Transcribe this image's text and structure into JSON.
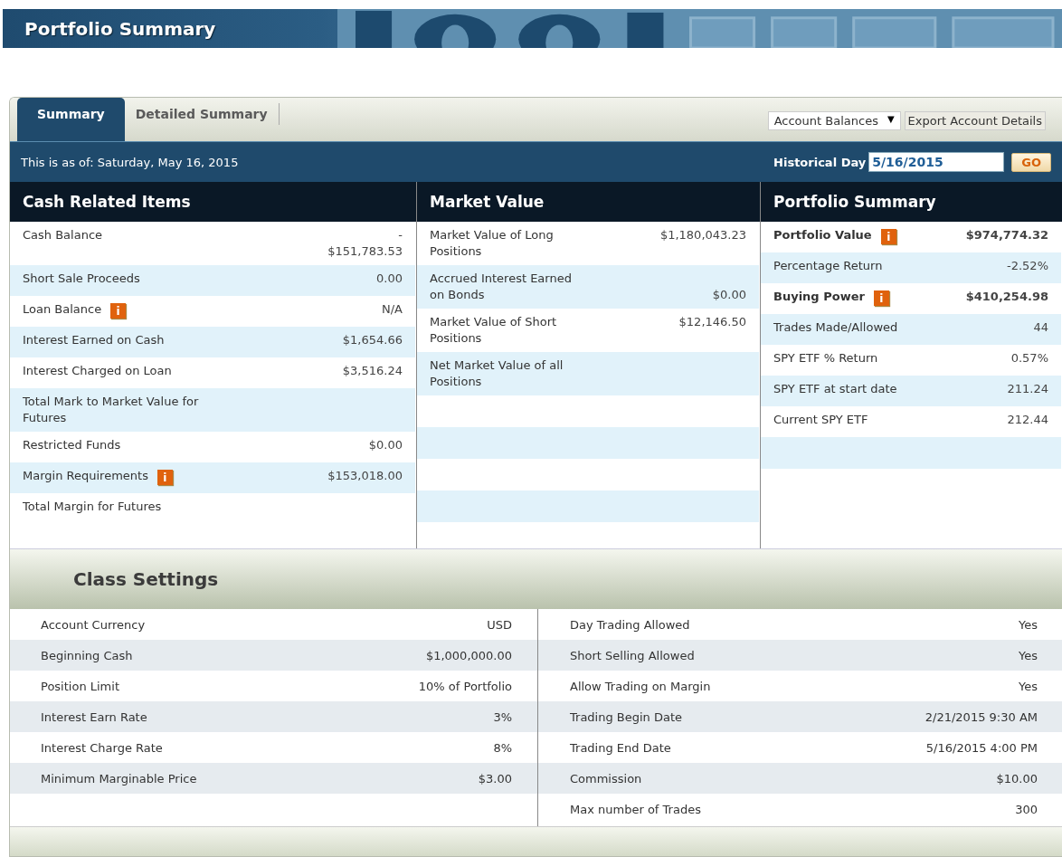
{
  "banner": {
    "title": "Portfolio Summary"
  },
  "tabs": [
    {
      "label": "Summary",
      "selected": true
    },
    {
      "label": "Detailed Summary",
      "selected": false
    }
  ],
  "toolbar": {
    "dropdown": "Account Balances",
    "dropdown_caret": "▼",
    "export_button": "Export Account Details"
  },
  "status_bar": {
    "as_of": "This is as of: Saturday, May 16, 2015",
    "historical_label": "Historical Day",
    "historical_value": "5/16/2015",
    "go_button": "GO"
  },
  "columns": [
    {
      "title": "Cash Related Items",
      "rows": [
        {
          "label": "Cash Balance",
          "value": "-\n$151,783.53",
          "bold": false
        },
        {
          "label": "Short Sale Proceeds",
          "value": "0.00",
          "bold": false
        },
        {
          "label": "Loan Balance",
          "value": "N/A",
          "info_icon": "i",
          "bold": false
        },
        {
          "label": "Interest Earned on Cash",
          "value": "$1,654.66",
          "bold": false
        },
        {
          "label": "Interest Charged on Loan",
          "value": "$3,516.24",
          "bold": false
        },
        {
          "label": "Total Mark to Market Value for Futures",
          "bold": false
        },
        {
          "label": "Restricted Funds",
          "value": "$0.00",
          "bold": false
        },
        {
          "label": "Margin Requirements",
          "value": "$153,018.00",
          "info_icon": "i",
          "bold": false
        },
        {
          "label": "Total Margin for Futures",
          "bold": false
        }
      ]
    },
    {
      "title": "Market Value",
      "rows": [
        {
          "label": "Market Value of Long Positions",
          "value": "$1,180,043.23",
          "bold": false
        },
        {
          "label": "Accrued Interest Earned on Bonds",
          "value": "$0.00",
          "bold": false
        },
        {
          "label": "Market Value of Short Positions",
          "value": "$12,146.50",
          "bold": false
        },
        {
          "label": "Net Market Value of all Positions",
          "bold": false
        }
      ]
    },
    {
      "title": "Portfolio Summary",
      "rows": [
        {
          "label": "Portfolio Value",
          "value": "$974,774.32",
          "info_icon": "i",
          "bold": true
        },
        {
          "label": "Percentage Return",
          "value": "-2.52%",
          "bold": false
        },
        {
          "label": "Buying Power",
          "value": "$410,254.98",
          "info_icon": "i",
          "bold": true
        },
        {
          "label": "Trades Made/Allowed",
          "value": "44",
          "bold": false
        },
        {
          "label": "SPY ETF % Return",
          "value": "0.57%",
          "bold": false
        },
        {
          "label": "SPY ETF at start date",
          "value": "211.24",
          "bold": false
        },
        {
          "label": "Current SPY ETF",
          "value": "212.44",
          "bold": false
        }
      ]
    }
  ],
  "class_settings": {
    "title": "Class Settings",
    "columns": [
      [
        {
          "label": "Account Currency",
          "value": "USD"
        },
        {
          "label": "Beginning Cash",
          "value": "$1,000,000.00"
        },
        {
          "label": "Position Limit",
          "value": "10% of Portfolio"
        },
        {
          "label": "Interest Earn Rate",
          "value": "3%"
        },
        {
          "label": "Interest Charge Rate",
          "value": "8%"
        },
        {
          "label": "Minimum Marginable Price",
          "value": "$3.00"
        }
      ],
      [
        {
          "label": "Day Trading Allowed",
          "value": "Yes"
        },
        {
          "label": "Short Selling Allowed",
          "value": "Yes"
        },
        {
          "label": "Allow Trading on Margin",
          "value": "Yes"
        },
        {
          "label": "Trading Begin Date",
          "value": "2/21/2015 9:30 AM"
        },
        {
          "label": "Trading End Date",
          "value": "5/16/2015 4:00 PM"
        },
        {
          "label": "Commission",
          "value": "$10.00"
        },
        {
          "label": "Max number of Trades",
          "value": "300"
        }
      ]
    ]
  }
}
